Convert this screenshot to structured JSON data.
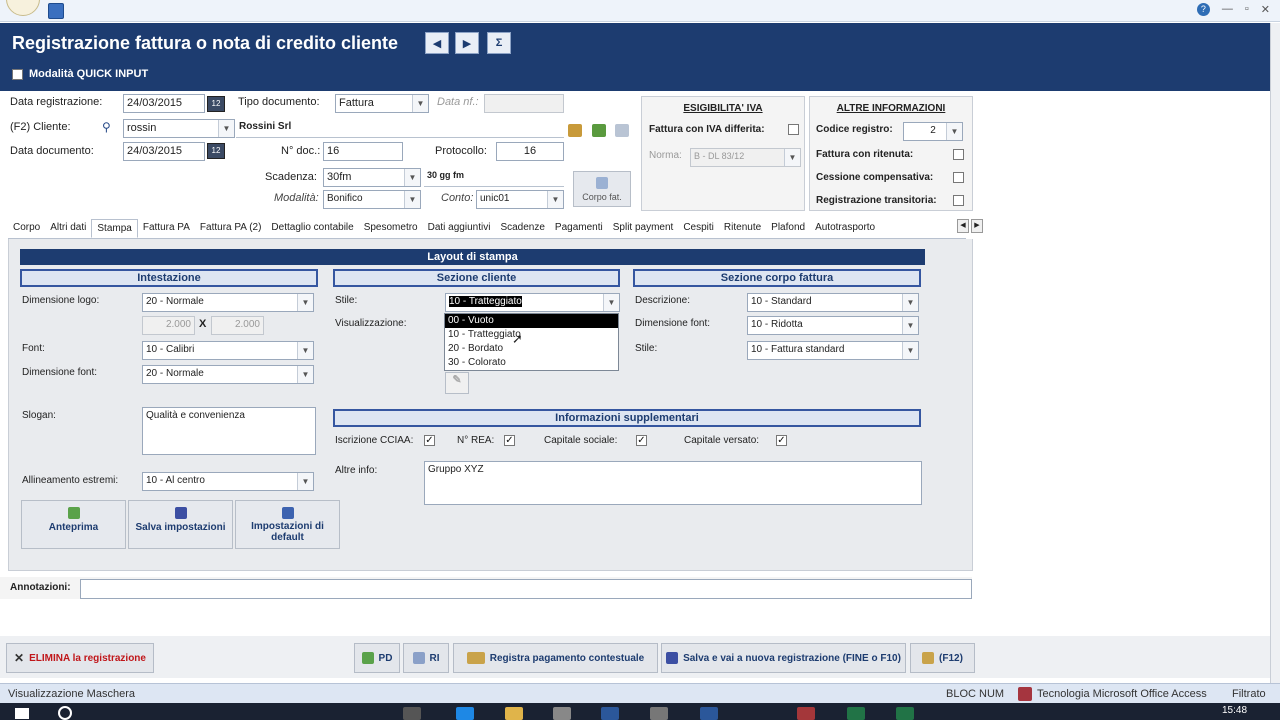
{
  "window": {
    "title": "Registrazione fattura o nota di credito cliente",
    "sum_label": "Σ"
  },
  "quick_input": {
    "label": "Modalità QUICK INPUT",
    "checked": false
  },
  "form": {
    "data_registrazione_label": "Data registrazione:",
    "data_registrazione": "24/03/2015",
    "tipo_documento_label": "Tipo documento:",
    "tipo_documento": "Fattura",
    "data_nf_label": "Data nf.:",
    "cliente_label": "(F2) Cliente:",
    "cliente_code": "rossin",
    "cliente_name": "Rossini Srl",
    "data_documento_label": "Data documento:",
    "data_documento": "24/03/2015",
    "n_doc_label": "N° doc.:",
    "n_doc": "16",
    "protocollo_label": "Protocollo:",
    "protocollo": "16",
    "scadenza_label": "Scadenza:",
    "scadenza": "30fm",
    "scadenza_desc": "30 gg fm",
    "modalita_label": "Modalità:",
    "modalita": "Bonifico",
    "conto_label": "Conto:",
    "conto": "unic01",
    "corpo_fat_label": "Corpo fat."
  },
  "esigibilita": {
    "title": "ESIGIBILITA' IVA",
    "iva_differita_label": "Fattura con IVA differita:",
    "norma_label": "Norma:",
    "norma": "B - DL 83/12"
  },
  "altre_info": {
    "title": "ALTRE INFORMAZIONI",
    "codice_registro_label": "Codice registro:",
    "codice_registro": "2",
    "ritenuta_label": "Fattura con ritenuta:",
    "compensativa_label": "Cessione compensativa:",
    "transitoria_label": "Registrazione transitoria:"
  },
  "tabs": [
    {
      "label": "Corpo"
    },
    {
      "label": "Altri dati"
    },
    {
      "label": "Stampa",
      "active": true
    },
    {
      "label": "Fattura PA"
    },
    {
      "label": "Fattura PA (2)"
    },
    {
      "label": "Dettaglio contabile"
    },
    {
      "label": "Spesometro"
    },
    {
      "label": "Dati aggiuntivi"
    },
    {
      "label": "Scadenze"
    },
    {
      "label": "Pagamenti"
    },
    {
      "label": "Split payment"
    },
    {
      "label": "Cespiti"
    },
    {
      "label": "Ritenute"
    },
    {
      "label": "Plafond"
    },
    {
      "label": "Autotrasporto"
    }
  ],
  "stampa": {
    "layout_title": "Layout di stampa",
    "intestazione": {
      "title": "Intestazione",
      "dim_logo_label": "Dimensione logo:",
      "dim_logo": "20 - Normale",
      "logo_w": "2.000",
      "logo_x": "X",
      "logo_h": "2.000",
      "font_label": "Font:",
      "font": "10 - Calibri",
      "dim_font_label": "Dimensione font:",
      "dim_font": "20 - Normale",
      "slogan_label": "Slogan:",
      "slogan": "Qualità e convenienza",
      "allineamento_label": "Allineamento estremi:",
      "allineamento": "10 - Al centro"
    },
    "sezione_cliente": {
      "title": "Sezione cliente",
      "stile_label": "Stile:",
      "stile": "10 - Tratteggiato",
      "visualizzazione_label": "Visualizzazione:",
      "options": [
        "00 - Vuoto",
        "10 - Tratteggiato",
        "20 - Bordato",
        "30 - Colorato"
      ]
    },
    "sezione_corpo": {
      "title": "Sezione corpo fattura",
      "descrizione_label": "Descrizione:",
      "descrizione": "10 - Standard",
      "dim_font_label": "Dimensione font:",
      "dim_font": "10 - Ridotta",
      "stile_label": "Stile:",
      "stile": "10 - Fattura standard"
    },
    "info_supp": {
      "title": "Informazioni supplementari",
      "cciaa_label": "Iscrizione CCIAA:",
      "rea_label": "N° REA:",
      "cap_sociale_label": "Capitale sociale:",
      "cap_versato_label": "Capitale versato:",
      "altre_info_label": "Altre info:",
      "altre_info": "Gruppo XYZ"
    },
    "buttons": {
      "anteprima": "Anteprima",
      "salva": "Salva impostazioni",
      "default": "Impostazioni di default"
    }
  },
  "annotazioni_label": "Annotazioni:",
  "footer_buttons": {
    "elimina": "ELIMINA la registrazione",
    "pd": "PD",
    "ri": "RI",
    "pagamento": "Registra pagamento contestuale",
    "salva_nuova": "Salva e vai a nuova registrazione (FINE o F10)",
    "f12": "(F12)"
  },
  "status": {
    "left": "Visualizzazione Maschera",
    "bloc": "BLOC NUM",
    "access": "Tecnologia Microsoft Office Access",
    "filtrato": "Filtrato"
  },
  "taskbar": {
    "clock": "15:48"
  },
  "colors": {
    "header": "#1d3c70",
    "accent": "#3556a0",
    "delete": "#c0161a"
  }
}
